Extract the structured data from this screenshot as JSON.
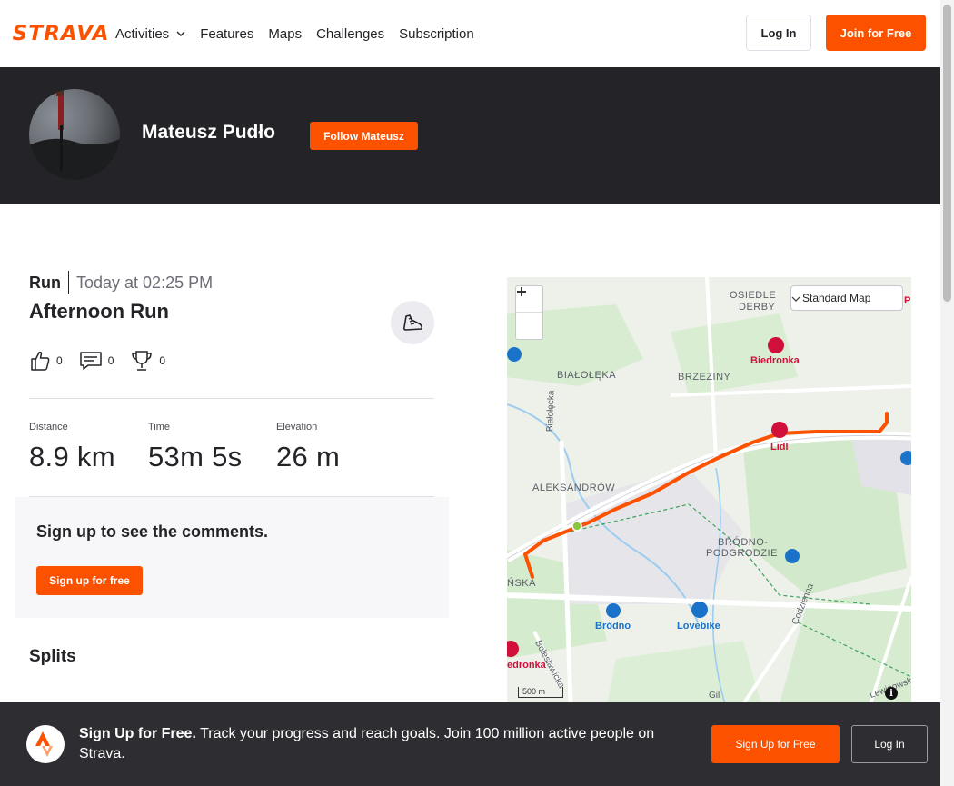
{
  "nav": {
    "logo": "STRAVA",
    "items": [
      "Activities",
      "Features",
      "Maps",
      "Challenges",
      "Subscription"
    ],
    "login_label": "Log In",
    "join_label": "Join for Free"
  },
  "athlete": {
    "name": "Mateusz Pudło",
    "follow_label": "Follow Mateusz"
  },
  "activity": {
    "type": "Run",
    "date": "Today at 02:25 PM",
    "title": "Afternoon Run",
    "kudos_count": "0",
    "comments_count": "0",
    "achievements_count": "0",
    "stats": [
      {
        "label": "Distance",
        "value": "8.9 km"
      },
      {
        "label": "Time",
        "value": "53m 5s"
      },
      {
        "label": "Elevation",
        "value": "26 m"
      }
    ]
  },
  "comments": {
    "heading": "Sign up to see the comments.",
    "button_label": "Sign up for free"
  },
  "splits": {
    "heading": "Splits"
  },
  "map": {
    "type_selector": "Standard Map",
    "scale": "500 m",
    "labels": {
      "osiedle": "OSIEDLE",
      "derby": "DERBY",
      "bialoleka": "BIAŁOŁĘKA",
      "brzeziny": "BRZEZINY",
      "bialolecka": "Białołęcka",
      "aleksandrow": "ALEKSANDRÓW",
      "brodno_podgrodzie_1": "BRÓDNO-",
      "brodno_podgrodzie_2": "PODGRODZIE",
      "nska": "ŃSKA",
      "boleslawicka": "Bolesławicka",
      "codzienna": "Codzienna",
      "lewinowska": "Lewinowska",
      "gil": "Gil",
      "pi": "Pi"
    },
    "pois": {
      "biedronka": "Biedronka",
      "lidl": "Lidl",
      "brodno": "Bródno",
      "lovebike": "Lovebike",
      "edronka": "edronka"
    },
    "colors": {
      "route": "#fc5200",
      "shop": "#d0103a",
      "poi_blue": "#1a73c8"
    }
  },
  "cta": {
    "bold": "Sign Up for Free.",
    "text": "Track your progress and reach goals. Join 100 million active people on Strava.",
    "signup_label": "Sign Up for Free",
    "login_label": "Log In"
  }
}
